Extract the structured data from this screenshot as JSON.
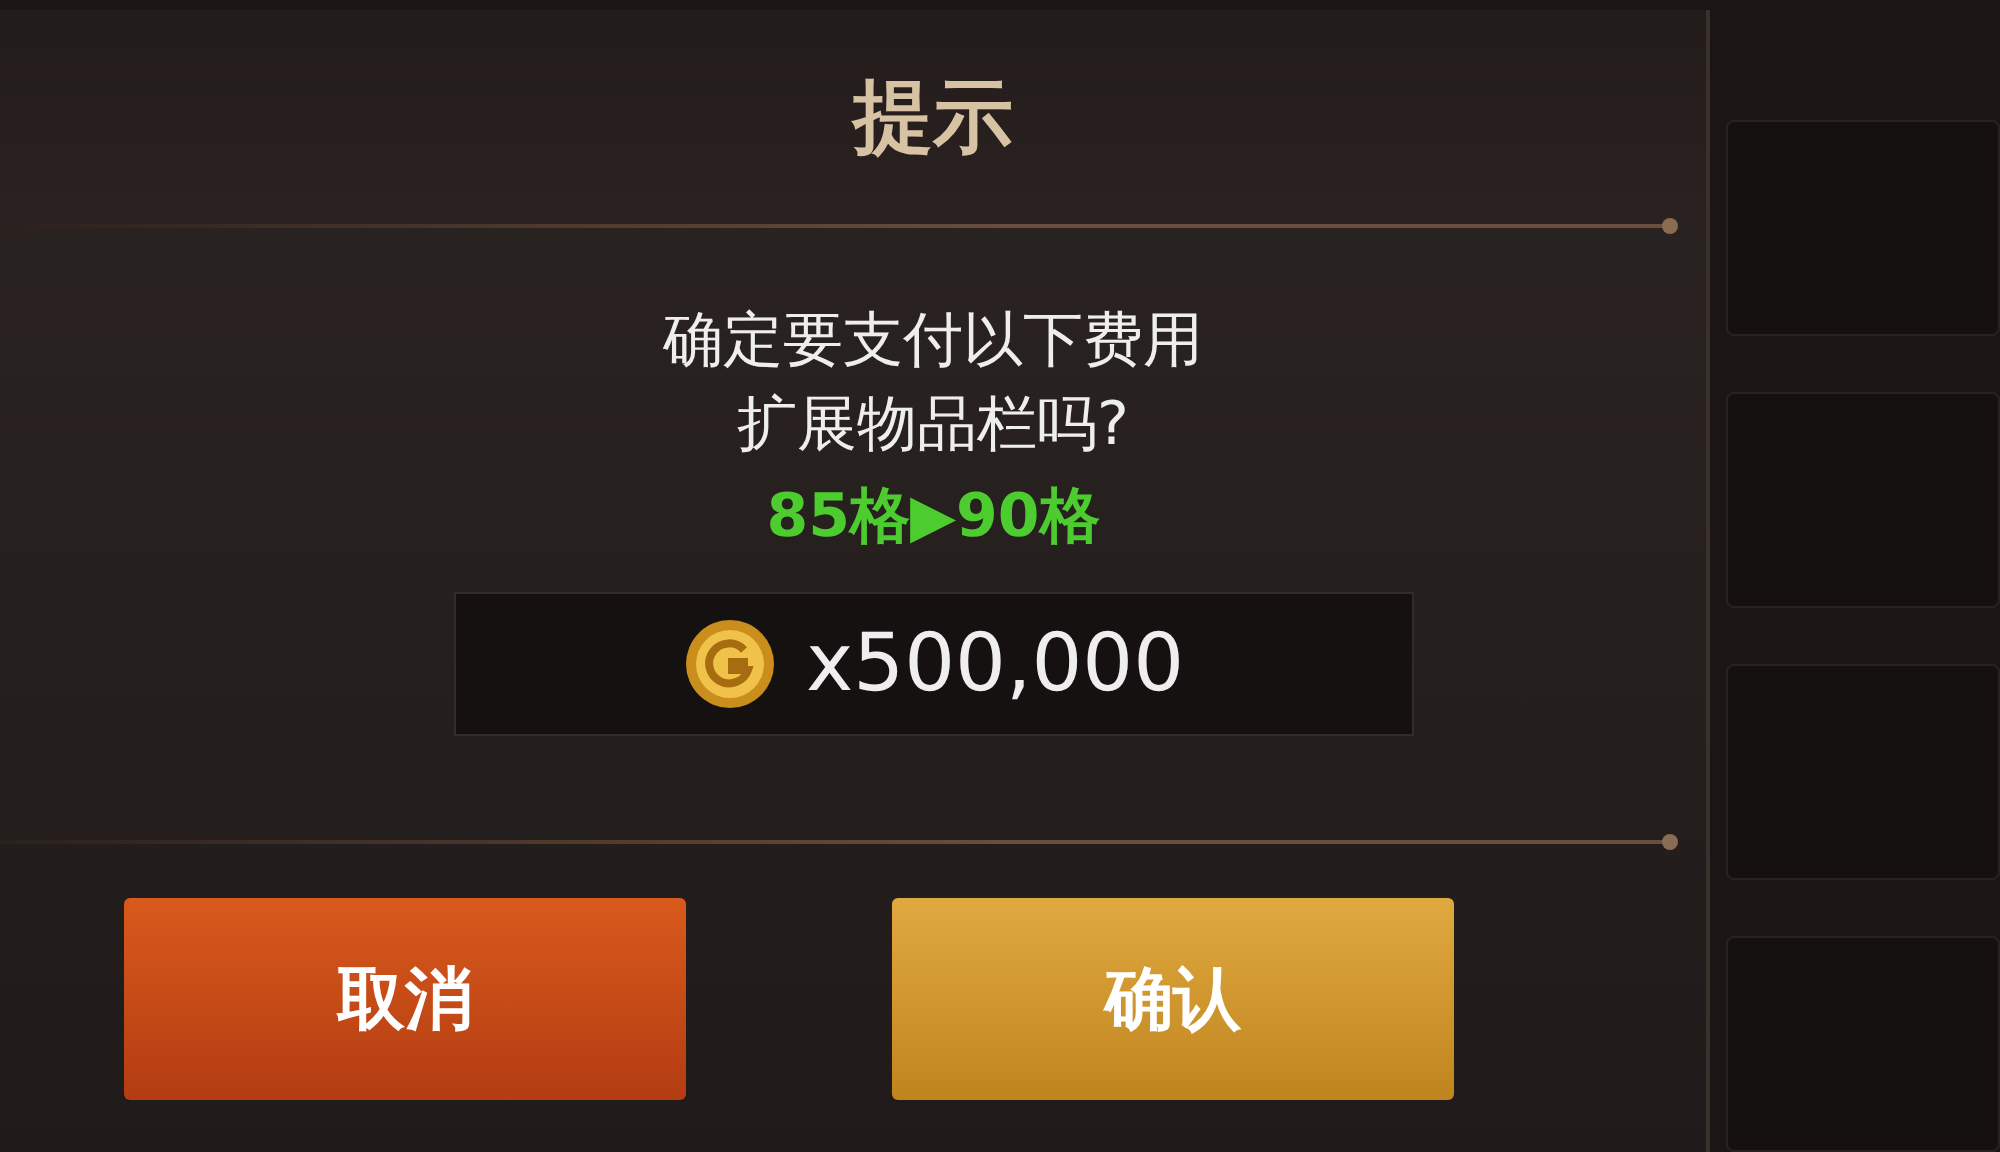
{
  "dialog": {
    "title": "提示",
    "message_lines": [
      "确定要支付以下费用",
      "扩展物品栏吗?"
    ],
    "highlight": "85格▶90格",
    "cost": {
      "amount": "x500,000"
    },
    "buttons": [
      {
        "label": "取消",
        "kind": "cancel"
      },
      {
        "label": "确认",
        "kind": "confirm"
      }
    ]
  }
}
